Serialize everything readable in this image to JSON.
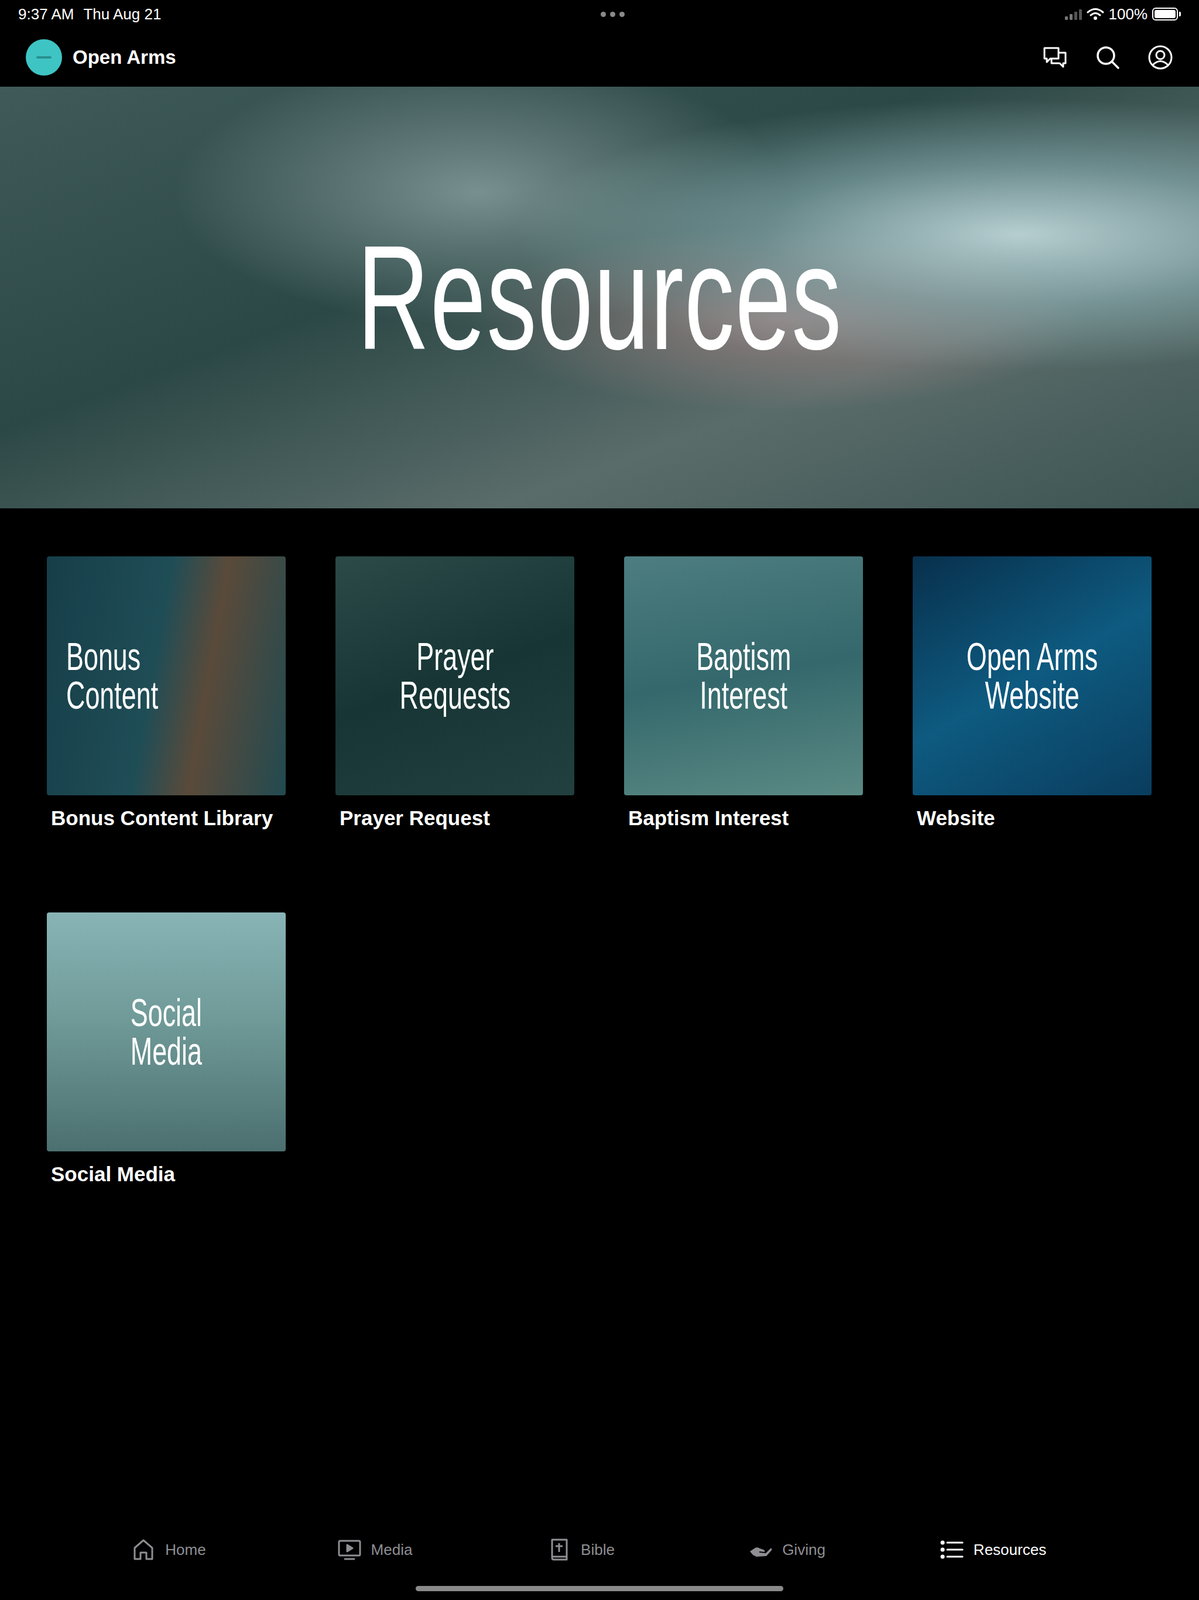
{
  "status_bar": {
    "time": "9:37 AM",
    "date": "Thu Aug 21",
    "battery": "100%",
    "battery_level": 1.0
  },
  "header": {
    "title": "Open Arms"
  },
  "hero": {
    "title": "Resources"
  },
  "tiles": [
    {
      "overlay": [
        "Bonus",
        "Content"
      ],
      "label": "Bonus Content Library"
    },
    {
      "overlay": [
        "Prayer",
        "Requests"
      ],
      "label": "Prayer Request"
    },
    {
      "overlay": [
        "Baptism",
        "Interest"
      ],
      "label": "Baptism Interest"
    },
    {
      "overlay": [
        "Open Arms",
        "Website"
      ],
      "label": "Website"
    },
    {
      "overlay": [
        "Social",
        "Media"
      ],
      "label": "Social Media"
    }
  ],
  "tabs": [
    {
      "label": "Home",
      "selected": false
    },
    {
      "label": "Media",
      "selected": false
    },
    {
      "label": "Bible",
      "selected": false
    },
    {
      "label": "Giving",
      "selected": false
    },
    {
      "label": "Resources",
      "selected": true
    }
  ]
}
